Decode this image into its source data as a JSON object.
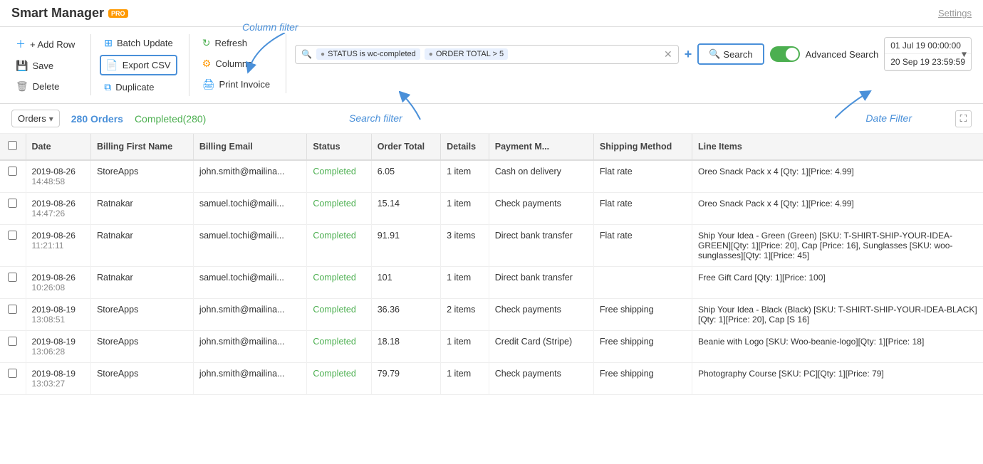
{
  "app": {
    "title": "Smart Manager",
    "pro_badge": "PRO",
    "settings_label": "Settings"
  },
  "toolbar": {
    "add_row": "+ Add Row",
    "save": "Save",
    "delete": "Delete",
    "batch_update": "Batch Update",
    "export_csv": "Export CSV",
    "duplicate": "Duplicate",
    "refresh": "Refresh",
    "columns": "Columns",
    "print_invoice": "Print Invoice"
  },
  "search": {
    "filter1": "STATUS is wc-completed",
    "filter2": "ORDER TOTAL > 5",
    "plus_label": "+",
    "search_label": "Search",
    "advanced_search_label": "Advanced Search"
  },
  "date_filter": {
    "from": "01 Jul 19 00:00:00",
    "to": "20 Sep 19 23:59:59"
  },
  "annotations": {
    "column_filter": "Column filter",
    "search_filter": "Search filter",
    "date_filter": "Date Filter"
  },
  "sub_bar": {
    "entity": "Orders",
    "order_count": "280 Orders",
    "completed": "Completed(280)"
  },
  "table": {
    "columns": [
      "",
      "Date",
      "Billing First Name",
      "Billing Email",
      "Status",
      "Order Total",
      "Details",
      "Payment M...",
      "Shipping Method",
      "Line Items"
    ],
    "rows": [
      {
        "date": "2019-08-26\n14:48:58",
        "billing_first": "StoreApps",
        "billing_email": "john.smith@mailina...",
        "status": "Completed",
        "order_total": "6.05",
        "details": "1 item",
        "payment": "Cash on delivery",
        "shipping": "Flat rate",
        "line_items": "Oreo Snack Pack x 4 [Qty: 1][Price: 4.99]"
      },
      {
        "date": "2019-08-26\n14:47:26",
        "billing_first": "Ratnakar",
        "billing_email": "samuel.tochi@maili...",
        "status": "Completed",
        "order_total": "15.14",
        "details": "1 item",
        "payment": "Check payments",
        "shipping": "Flat rate",
        "line_items": "Oreo Snack Pack x 4 [Qty: 1][Price: 4.99]"
      },
      {
        "date": "2019-08-26\n11:21:11",
        "billing_first": "Ratnakar",
        "billing_email": "samuel.tochi@maili...",
        "status": "Completed",
        "order_total": "91.91",
        "details": "3 items",
        "payment": "Direct bank transfer",
        "shipping": "Flat rate",
        "line_items": "Ship Your Idea - Green (Green) [SKU: T-SHIRT-SHIP-YOUR-IDEA-GREEN][Qty: 1][Price: 20], Cap [Price: 16], Sunglasses [SKU: woo-sunglasses][Qty: 1][Price: 45]"
      },
      {
        "date": "2019-08-26\n10:26:08",
        "billing_first": "Ratnakar",
        "billing_email": "samuel.tochi@maili...",
        "status": "Completed",
        "order_total": "101",
        "details": "1 item",
        "payment": "Direct bank transfer",
        "shipping": "",
        "line_items": "Free Gift Card [Qty: 1][Price: 100]"
      },
      {
        "date": "2019-08-19\n13:08:51",
        "billing_first": "StoreApps",
        "billing_email": "john.smith@mailina...",
        "status": "Completed",
        "order_total": "36.36",
        "details": "2 items",
        "payment": "Check payments",
        "shipping": "Free shipping",
        "line_items": "Ship Your Idea - Black (Black) [SKU: T-SHIRT-SHIP-YOUR-IDEA-BLACK][Qty: 1][Price: 20], Cap [S 16]"
      },
      {
        "date": "2019-08-19\n13:06:28",
        "billing_first": "StoreApps",
        "billing_email": "john.smith@mailina...",
        "status": "Completed",
        "order_total": "18.18",
        "details": "1 item",
        "payment": "Credit Card (Stripe)",
        "shipping": "Free shipping",
        "line_items": "Beanie with Logo [SKU: Woo-beanie-logo][Qty: 1][Price: 18]"
      },
      {
        "date": "2019-08-19\n13:03:27",
        "billing_first": "StoreApps",
        "billing_email": "john.smith@mailina...",
        "status": "Completed",
        "order_total": "79.79",
        "details": "1 item",
        "payment": "Check payments",
        "shipping": "Free shipping",
        "line_items": "Photography Course [SKU: PC][Qty: 1][Price: 79]"
      }
    ]
  }
}
